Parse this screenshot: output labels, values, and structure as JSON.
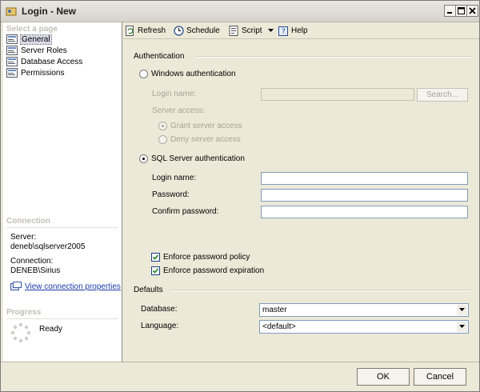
{
  "window": {
    "title": "Login - New"
  },
  "sidebar": {
    "select_heading": "Select a page",
    "pages": [
      {
        "label": "General",
        "icon": "page-icon",
        "selected": true
      },
      {
        "label": "Server Roles",
        "icon": "page-icon"
      },
      {
        "label": "Database Access",
        "icon": "page-icon"
      },
      {
        "label": "Permissions",
        "icon": "page-icon"
      }
    ],
    "connection_heading": "Connection",
    "server_label": "Server:",
    "server_value": "deneb\\sqlserver2005",
    "connection_label": "Connection:",
    "connection_value": "DENEB\\Sirius",
    "view_connection_link": "View connection properties",
    "progress_heading": "Progress",
    "progress_status": "Ready"
  },
  "toolbar": {
    "refresh": "Refresh",
    "schedule": "Schedule",
    "script": "Script",
    "help": "Help"
  },
  "auth": {
    "group_label": "Authentication",
    "windows_auth": "Windows authentication",
    "login_name_label_disabled": "Login name:",
    "login_name_disabled_value": "",
    "search_button": "Search...",
    "server_access_label": "Server access:",
    "grant_access": "Grant server access",
    "deny_access": "Deny server access",
    "sql_auth": "SQL Server authentication",
    "login_name_label": "Login name:",
    "login_name_value": "",
    "password_label": "Password:",
    "password_value": "",
    "confirm_password_label": "Confirm password:",
    "confirm_password_value": "",
    "enforce_policy": "Enforce password policy",
    "enforce_expiration": "Enforce password expiration"
  },
  "defaults": {
    "group_label": "Defaults",
    "database_label": "Database:",
    "database_value": "master",
    "language_label": "Language:",
    "language_value": "<default>"
  },
  "buttons": {
    "ok": "OK",
    "cancel": "Cancel"
  }
}
